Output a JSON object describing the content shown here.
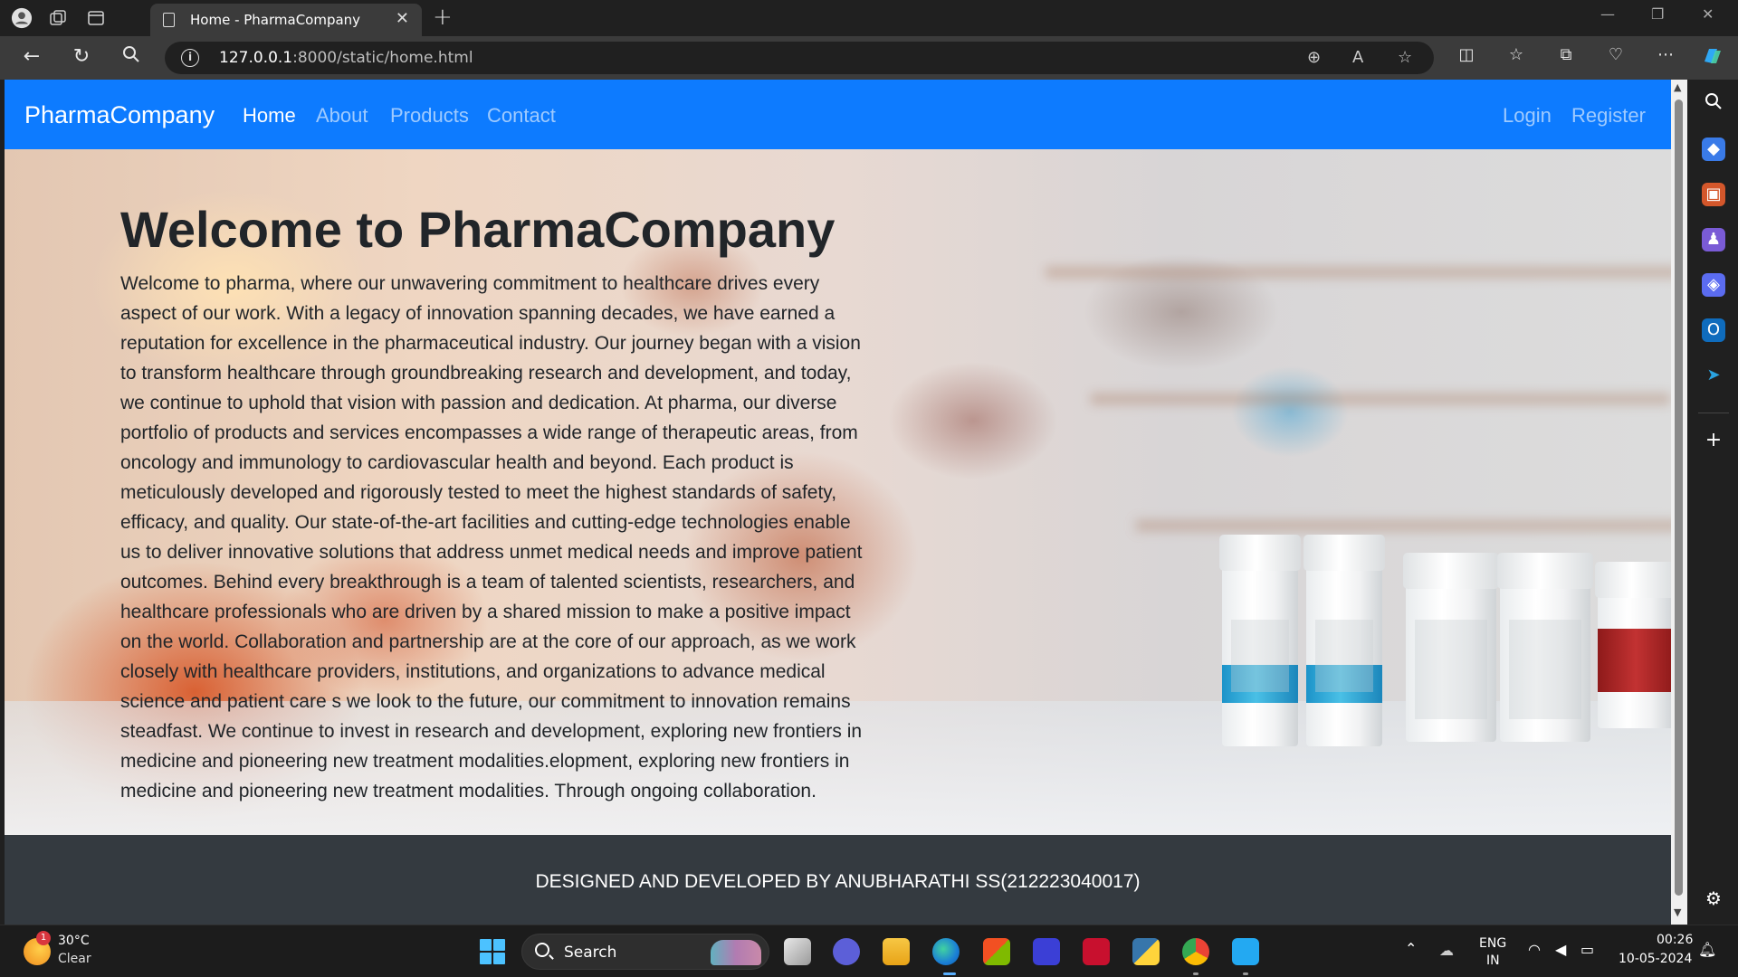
{
  "browser": {
    "tab_title": "Home - PharmaCompany",
    "url_host": "127.0.0.1",
    "url_rest": ":8000/static/home.html"
  },
  "page": {
    "brand": "PharmaCompany",
    "nav": {
      "home": "Home",
      "about": "About",
      "products": "Products",
      "contact": "Contact",
      "login": "Login",
      "register": "Register"
    },
    "hero": {
      "title": "Welcome to PharmaCompany",
      "text": "Welcome to pharma, where our unwavering commitment to healthcare drives every aspect of our work. With a legacy of innovation spanning decades, we have earned a reputation for excellence in the pharmaceutical industry. Our journey began with a vision to transform healthcare through groundbreaking research and development, and today, we continue to uphold that vision with passion and dedication. At pharma, our diverse portfolio of products and services encompasses a wide range of therapeutic areas, from oncology and immunology to cardiovascular health and beyond. Each product is meticulously developed and rigorously tested to meet the highest standards of safety, efficacy, and quality. Our state-of-the-art facilities and cutting-edge technologies enable us to deliver innovative solutions that address unmet medical needs and improve patient outcomes. Behind every breakthrough is a team of talented scientists, researchers, and healthcare professionals who are driven by a shared mission to make a positive impact on the world. Collaboration and partnership are at the core of our approach, as we work closely with healthcare providers, institutions, and organizations to advance medical science and patient care s we look to the future, our commitment to innovation remains steadfast. We continue to invest in research and development, exploring new frontiers in medicine and pioneering new treatment modalities.elopment, exploring new frontiers in medicine and pioneering new treatment modalities. Through ongoing collaboration."
    },
    "footer": "DESIGNED AND DEVELOPED BY ANUBHARATHI SS(212223040017)"
  },
  "taskbar": {
    "weather_temp": "30°C",
    "weather_desc": "Clear",
    "weather_badge": "1",
    "search": "Search",
    "lang_top": "ENG",
    "lang_bottom": "IN",
    "time": "00:26",
    "date": "10-05-2024"
  },
  "colors": {
    "navbar": "#0d7bff",
    "footer": "#343a40",
    "browser_chrome": "#202020"
  }
}
